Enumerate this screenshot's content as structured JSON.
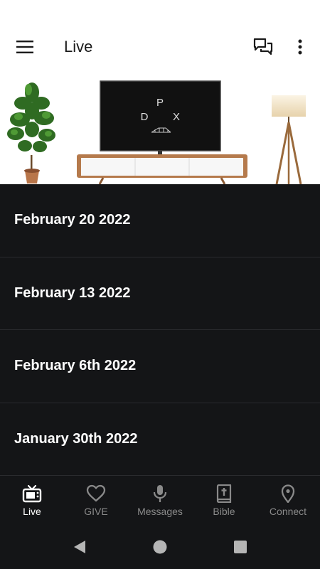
{
  "app_bar": {
    "title": "Live",
    "icons": [
      "menu-icon",
      "chat-icon",
      "more-vert-icon"
    ]
  },
  "hero": {
    "tv_logo_letters": [
      "P",
      "D",
      "X"
    ]
  },
  "services": [
    {
      "label": "February 20 2022"
    },
    {
      "label": "February 13 2022"
    },
    {
      "label": "February 6th 2022"
    },
    {
      "label": "January 30th 2022"
    }
  ],
  "bottom_nav": {
    "items": [
      {
        "label": "Live",
        "icon": "tv-icon",
        "active": true
      },
      {
        "label": "GIVE",
        "icon": "heart-icon",
        "active": false
      },
      {
        "label": "Messages",
        "icon": "microphone-icon",
        "active": false
      },
      {
        "label": "Bible",
        "icon": "bible-icon",
        "active": false
      },
      {
        "label": "Connect",
        "icon": "location-pin-icon",
        "active": false
      }
    ]
  },
  "colors": {
    "list_background": "#141517",
    "divider": "#2a2b2e",
    "active_nav": "#ffffff",
    "inactive_nav": "#8a8a8a"
  }
}
